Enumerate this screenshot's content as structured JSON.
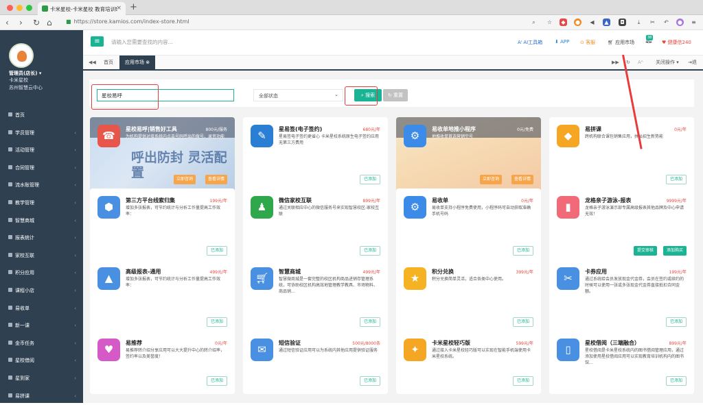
{
  "browser": {
    "tab_title": "卡米星校-卡米星校 教育培训t",
    "url": "https://store.kamios.com/index-store.html"
  },
  "sidebar": {
    "user_name": "管理员(店长) ▾",
    "user_role": "卡米星校",
    "user_org": "苏州智慧云中心",
    "items": [
      "首页",
      "学员管理",
      "活动管理",
      "合同管理",
      "流水账管理",
      "教学管理",
      "智慧商城",
      "报表统计",
      "家校互联",
      "积分应用",
      "课程小店",
      "易收单",
      "新一课",
      "金币任务",
      "星校借阅",
      "星到家",
      "易拼课"
    ]
  },
  "topbar": {
    "search_placeholder": "请输入您需要查找的内容...",
    "ai": "AI工具箱",
    "app": "APP",
    "service": "客服",
    "market": "应用市场",
    "badge": "38",
    "health": "健康信240"
  },
  "tabs": {
    "home": "首页",
    "market": "应用市场",
    "close_ops": "关闭操作 ▾",
    "exit": "退出"
  },
  "filter": {
    "search_value": "星校易呼",
    "status": "全部状态",
    "search_btn": "搜索",
    "reset_btn": "重置"
  },
  "cards": [
    {
      "name": "星校易呼|销售好工具",
      "price": "800元/服务",
      "desc": "为机构提供对接系统内点击号码呼出的拨号、录音功能",
      "big": "呼出防封 灵活配置",
      "b1": "立即咨询",
      "b2": "查看详情",
      "color": "#e8554a"
    },
    {
      "name": "星易签(电子签约)",
      "price": "680元/年",
      "desc": "星易签电子签约更省心 卡米星校系统原生电子签约应用无第三方费用",
      "added": "已添加",
      "color": "#2a7fd4"
    },
    {
      "name": "易收单地推小程序",
      "price": "0元/免费",
      "desc": "地推收单首选营销空号",
      "b1": "立即咨询",
      "b2": "查看详情",
      "color": "#3c8be8"
    },
    {
      "name": "易拼课",
      "price": "0元/年",
      "desc": "跨机构联合课包销售应用，拼出招生新势能",
      "added": "已添加",
      "color": "#f5a623"
    },
    {
      "name": "第三方平台线索归集",
      "price": "199元/年",
      "desc": "增加多张报表，可节约统计与分析工作量提高工作效率：",
      "added": "已添加",
      "color": "#4a90e2"
    },
    {
      "name": "微信家校互联",
      "price": "899元/年",
      "desc": "通过关联相应中心的微信服务号来实现智慧校区-家校互联",
      "added": "已添加",
      "color": "#2ea84a"
    },
    {
      "name": "易收单",
      "price": "0元/年",
      "desc": "易收单支持小程序免费使用，小程序码可自动获取准确手机号码",
      "added": "已添加",
      "color": "#3c8be8"
    },
    {
      "name": "龙格亲子游泳-报表",
      "price": "9999元/年",
      "desc": "龙格亲子游泳演示部专属高级报表其他品牌及中心申请无效！",
      "b1": "提交审核",
      "b2": "添加购买",
      "color": "#f06a78"
    },
    {
      "name": "高级报表-通用",
      "price": "499元/年",
      "desc": "增加多张报表，可节约统计与分析工作量提高工作效率：",
      "added": "已添加",
      "color": "#4a90e2"
    },
    {
      "name": "智慧商城",
      "price": "499元/年",
      "desc": "智慧微商城是一套完整的校区机构商品进销存管理系统，可协助校区机构高效地管理教学教具、市场物料、商品销…",
      "added": "已添加",
      "color": "#4a90e2"
    },
    {
      "name": "积分兑换",
      "price": "399元/年",
      "desc": "积分兑换简单灵活，适合各类中心使用。",
      "added": "已添加",
      "color": "#f5b323"
    },
    {
      "name": "卡券应用",
      "price": "199元/年",
      "desc": "通过系统给会员发放现金代金券，会员在签约或续约的时候可以使用一张或多张现金代金券直接抵扣合同金额。",
      "added": "已添加",
      "color": "#4a90e2"
    },
    {
      "name": "易推荐",
      "price": "0元/年",
      "desc": "易推荐转介绍分享应用可以大大提升中心的转介绍率，签约率以及美誉度！",
      "added": "已添加",
      "color": "#d55ac8"
    },
    {
      "name": "短信验证",
      "price": "500元/8000条",
      "desc": "通过短信验证应用可以为系统内其他应用提供验证服务",
      "added": "已添加",
      "color": "#4a90e2"
    },
    {
      "name": "卡米星校轻巧版",
      "price": "599元/年",
      "desc": "通过接入卡米星校轻巧版可以实现在智能手机端使用卡米星校系统。",
      "added": "已添加",
      "color": "#f5a623"
    },
    {
      "name": "星校借阅（三端融合）",
      "price": "899元/年",
      "desc": "星校借阅是卡米星校系统内的图书借阅管理应用，通过添加使用星校借阅应用可以实现教育培训机构内的图书馆…",
      "added": "已添加",
      "color": "#4a90e2"
    }
  ]
}
